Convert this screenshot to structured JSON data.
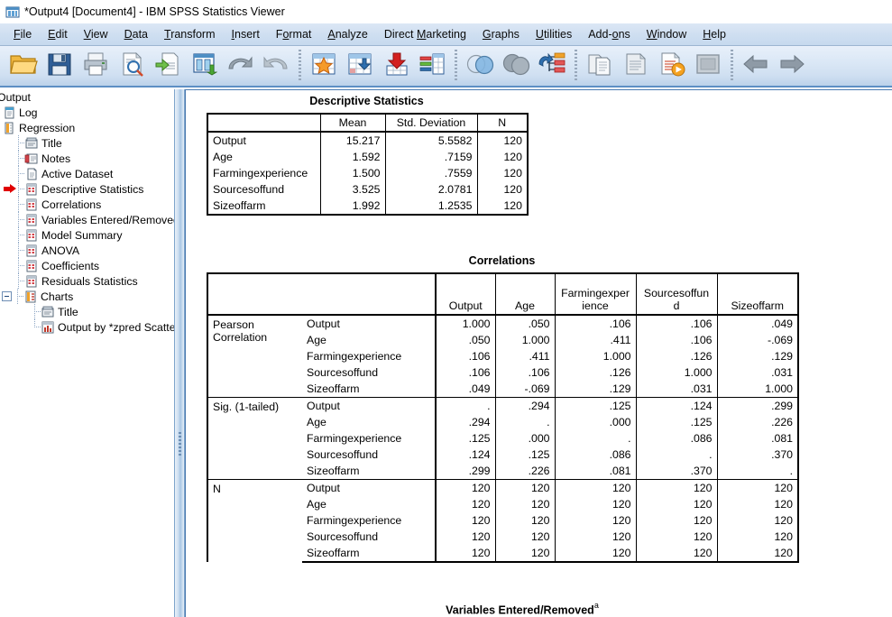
{
  "window": {
    "title": "*Output4 [Document4] - IBM SPSS Statistics Viewer",
    "icon": "spss-viewer-icon"
  },
  "menubar": {
    "items": [
      {
        "label": "File",
        "accel": "F"
      },
      {
        "label": "Edit",
        "accel": "E"
      },
      {
        "label": "View",
        "accel": "V"
      },
      {
        "label": "Data",
        "accel": "D"
      },
      {
        "label": "Transform",
        "accel": "T"
      },
      {
        "label": "Insert",
        "accel": "I"
      },
      {
        "label": "Format",
        "accel": "o"
      },
      {
        "label": "Analyze",
        "accel": "A"
      },
      {
        "label": "Direct Marketing",
        "accel": "M"
      },
      {
        "label": "Graphs",
        "accel": "G"
      },
      {
        "label": "Utilities",
        "accel": "U"
      },
      {
        "label": "Add-ons",
        "accel": "o"
      },
      {
        "label": "Window",
        "accel": "W"
      },
      {
        "label": "Help",
        "accel": "H"
      }
    ]
  },
  "toolbar": {
    "buttons": [
      {
        "name": "open-file-icon",
        "tooltip": "Open data document"
      },
      {
        "name": "save-icon",
        "tooltip": "Save this document"
      },
      {
        "name": "print-icon",
        "tooltip": "Print"
      },
      {
        "name": "print-preview-icon",
        "tooltip": "Print Preview"
      },
      {
        "name": "export-icon",
        "tooltip": "Export"
      },
      {
        "name": "goto-data-icon",
        "tooltip": "Go to data"
      },
      {
        "name": "undo-icon",
        "tooltip": "Undo"
      },
      {
        "name": "redo-icon",
        "tooltip": "Redo"
      },
      {
        "name": "goto-case-icon",
        "tooltip": "Go to case"
      },
      {
        "name": "variables-icon",
        "tooltip": "Variables"
      },
      {
        "name": "insert-cases-icon",
        "tooltip": "Insert cases"
      },
      {
        "name": "split-file-icon",
        "tooltip": "Split file"
      },
      {
        "name": "select-cases-icon",
        "tooltip": "Select cases"
      },
      {
        "name": "weight-cases-icon",
        "tooltip": "Weight cases"
      },
      {
        "name": "dialog-recall-icon",
        "tooltip": "Recall recently used dialogs"
      },
      {
        "name": "promote-icon",
        "tooltip": "Promote"
      },
      {
        "name": "demote-icon",
        "tooltip": "Demote"
      },
      {
        "name": "run-script-icon",
        "tooltip": "Run script"
      },
      {
        "name": "show-hide-icon",
        "tooltip": "Show / Hide"
      },
      {
        "name": "back-arrow-icon",
        "tooltip": "Back"
      },
      {
        "name": "forward-arrow-icon",
        "tooltip": "Forward"
      }
    ]
  },
  "outline": {
    "root": "Output",
    "items": [
      {
        "label": "Log",
        "icon": "log-icon",
        "level": 1,
        "marker": false
      },
      {
        "label": "Regression",
        "icon": "regression-icon",
        "level": 1,
        "marker": false,
        "expander": "minus"
      },
      {
        "label": "Title",
        "icon": "title-icon",
        "level": 2,
        "marker": false
      },
      {
        "label": "Notes",
        "icon": "notes-icon",
        "level": 2,
        "marker": false
      },
      {
        "label": "Active Dataset",
        "icon": "dataset-icon",
        "level": 2,
        "marker": false
      },
      {
        "label": "Descriptive Statistics",
        "icon": "table-icon",
        "level": 2,
        "marker": true
      },
      {
        "label": "Correlations",
        "icon": "table-icon",
        "level": 2,
        "marker": false
      },
      {
        "label": "Variables Entered/Removed",
        "icon": "table-icon",
        "level": 2,
        "marker": false
      },
      {
        "label": "Model Summary",
        "icon": "table-icon",
        "level": 2,
        "marker": false
      },
      {
        "label": "ANOVA",
        "icon": "table-icon",
        "level": 2,
        "marker": false
      },
      {
        "label": "Coefficients",
        "icon": "table-icon",
        "level": 2,
        "marker": false
      },
      {
        "label": "Residuals Statistics",
        "icon": "table-icon",
        "level": 2,
        "marker": false
      },
      {
        "label": "Charts",
        "icon": "charts-icon",
        "level": 2,
        "marker": false,
        "expander": "minus"
      },
      {
        "label": "Title",
        "icon": "title-icon",
        "level": 3,
        "marker": false
      },
      {
        "label": "Output by *zpred Scatterp",
        "icon": "chart-icon",
        "level": 3,
        "marker": false
      }
    ]
  },
  "output": {
    "descriptive": {
      "title": "Descriptive Statistics",
      "columns": [
        "",
        "Mean",
        "Std. Deviation",
        "N"
      ],
      "rows": [
        {
          "label": "Output",
          "mean": "15.217",
          "sd": "5.5582",
          "n": "120"
        },
        {
          "label": "Age",
          "mean": "1.592",
          "sd": ".7159",
          "n": "120"
        },
        {
          "label": "Farmingexperience",
          "mean": "1.500",
          "sd": ".7559",
          "n": "120"
        },
        {
          "label": "Sourcesoffund",
          "mean": "3.525",
          "sd": "2.0781",
          "n": "120"
        },
        {
          "label": "Sizeoffarm",
          "mean": "1.992",
          "sd": "1.2535",
          "n": "120"
        }
      ]
    },
    "correlations": {
      "title": "Correlations",
      "column_headers": [
        "Output",
        "Age",
        "Farmingexper\nience",
        "Sourcesoffun\nd",
        "Sizeoffarm"
      ],
      "blocks": [
        {
          "name": "Pearson Correlation",
          "rows": [
            {
              "label": "Output",
              "values": [
                "1.000",
                ".050",
                ".106",
                ".106",
                ".049"
              ]
            },
            {
              "label": "Age",
              "values": [
                ".050",
                "1.000",
                ".411",
                ".106",
                "-.069"
              ]
            },
            {
              "label": "Farmingexperience",
              "values": [
                ".106",
                ".411",
                "1.000",
                ".126",
                ".129"
              ]
            },
            {
              "label": "Sourcesoffund",
              "values": [
                ".106",
                ".106",
                ".126",
                "1.000",
                ".031"
              ]
            },
            {
              "label": "Sizeoffarm",
              "values": [
                ".049",
                "-.069",
                ".129",
                ".031",
                "1.000"
              ]
            }
          ]
        },
        {
          "name": "Sig. (1-tailed)",
          "rows": [
            {
              "label": "Output",
              "values": [
                ".",
                ".294",
                ".125",
                ".124",
                ".299"
              ]
            },
            {
              "label": "Age",
              "values": [
                ".294",
                ".",
                ".000",
                ".125",
                ".226"
              ]
            },
            {
              "label": "Farmingexperience",
              "values": [
                ".125",
                ".000",
                ".",
                ".086",
                ".081"
              ]
            },
            {
              "label": "Sourcesoffund",
              "values": [
                ".124",
                ".125",
                ".086",
                ".",
                ".370"
              ]
            },
            {
              "label": "Sizeoffarm",
              "values": [
                ".299",
                ".226",
                ".081",
                ".370",
                "."
              ]
            }
          ]
        },
        {
          "name": "N",
          "rows": [
            {
              "label": "Output",
              "values": [
                "120",
                "120",
                "120",
                "120",
                "120"
              ]
            },
            {
              "label": "Age",
              "values": [
                "120",
                "120",
                "120",
                "120",
                "120"
              ]
            },
            {
              "label": "Farmingexperience",
              "values": [
                "120",
                "120",
                "120",
                "120",
                "120"
              ]
            },
            {
              "label": "Sourcesoffund",
              "values": [
                "120",
                "120",
                "120",
                "120",
                "120"
              ]
            },
            {
              "label": "Sizeoffarm",
              "values": [
                "120",
                "120",
                "120",
                "120",
                "120"
              ]
            }
          ]
        }
      ]
    },
    "variables_entered": {
      "title": "Variables Entered/Removed",
      "footnote_marker": "a"
    }
  }
}
